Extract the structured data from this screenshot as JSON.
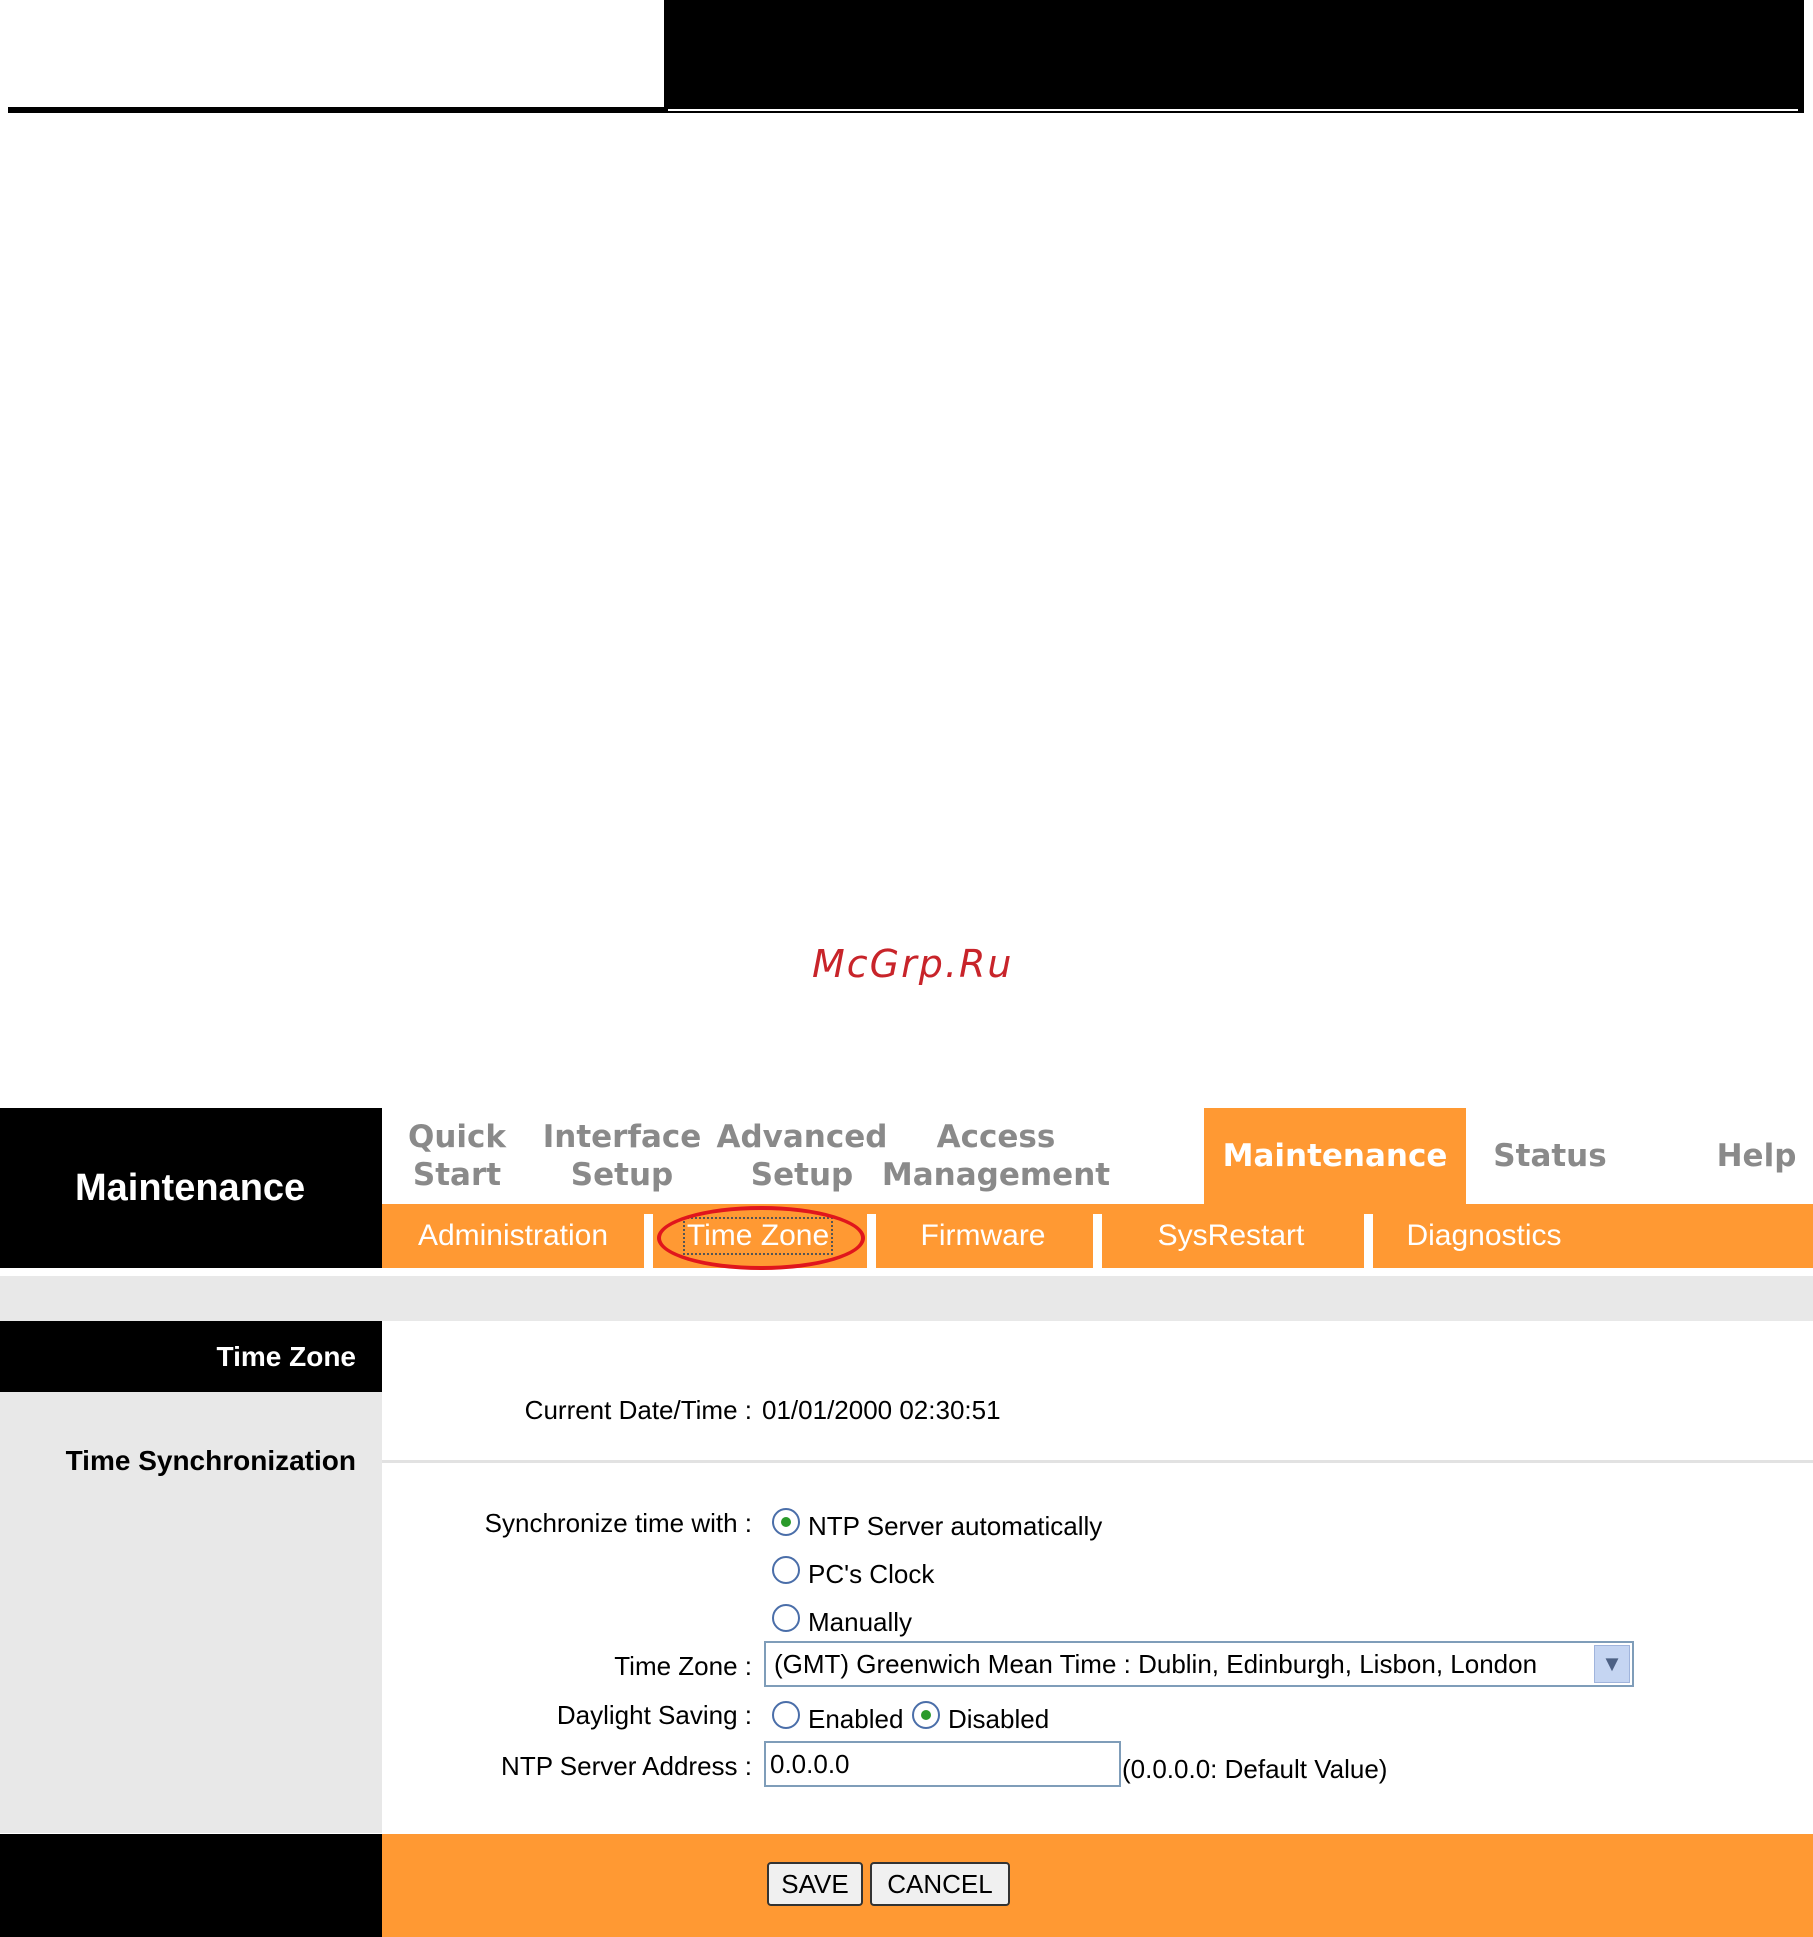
{
  "watermark": "McGrp.Ru",
  "brand": "Maintenance",
  "tabs": [
    {
      "line1": "Quick",
      "line2": "Start"
    },
    {
      "line1": "Interface",
      "line2": "Setup"
    },
    {
      "line1": "Advanced",
      "line2": "Setup"
    },
    {
      "line1": "Access",
      "line2": "Management"
    },
    {
      "line1": "Maintenance",
      "line2": ""
    },
    {
      "line1": "Status",
      "line2": ""
    },
    {
      "line1": "Help",
      "line2": ""
    }
  ],
  "subtabs": [
    "Administration",
    "Time Zone",
    "Firmware",
    "SysRestart",
    "Diagnostics"
  ],
  "section": {
    "title": "Time Zone",
    "sync_title": "Time Synchronization"
  },
  "form": {
    "current_label": "Current Date/Time :",
    "current_value": "01/01/2000 02:30:51",
    "sync_label": "Synchronize time with :",
    "sync_options": [
      "NTP Server automatically",
      "PC's Clock",
      "Manually"
    ],
    "sync_selected": "NTP Server automatically",
    "timezone_label": "Time Zone :",
    "timezone_value": "(GMT) Greenwich Mean Time : Dublin, Edinburgh, Lisbon, London",
    "dst_label": "Daylight Saving :",
    "dst_options": [
      "Enabled",
      "Disabled"
    ],
    "dst_selected": "Disabled",
    "ntp_label": "NTP Server Address :",
    "ntp_value": "0.0.0.0",
    "ntp_hint": "(0.0.0.0: Default Value)"
  },
  "buttons": {
    "save": "SAVE",
    "cancel": "CANCEL"
  },
  "colors": {
    "accent": "#ff9933",
    "highlight_circle": "#e0161c"
  }
}
